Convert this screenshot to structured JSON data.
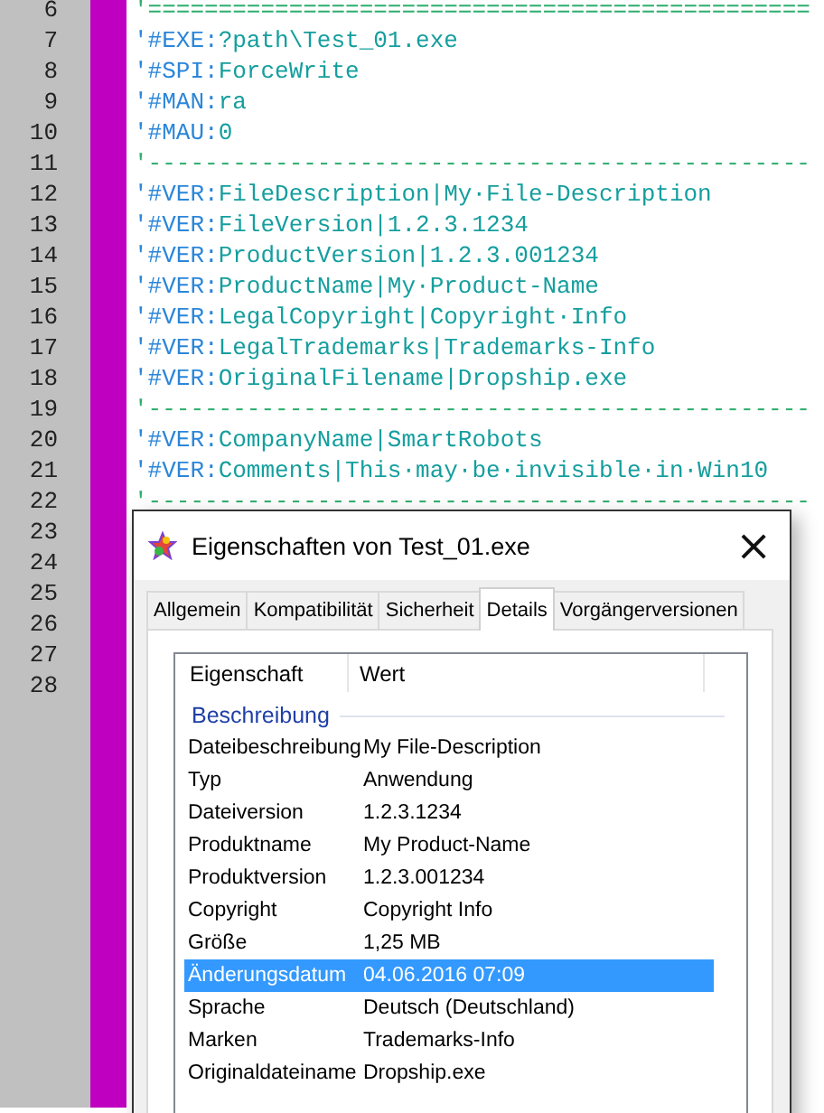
{
  "editor": {
    "lines": [
      {
        "number": "6",
        "kind": "separator",
        "text": "'==============================================="
      },
      {
        "number": "7",
        "kind": "directive",
        "key": "'#EXE:",
        "value": "?path\\Test_01.exe"
      },
      {
        "number": "8",
        "kind": "directive",
        "key": "'#SPI:",
        "value": "ForceWrite"
      },
      {
        "number": "9",
        "kind": "directive",
        "key": "'#MAN:",
        "value": "ra"
      },
      {
        "number": "10",
        "kind": "directive",
        "key": "'#MAU:",
        "value": "0"
      },
      {
        "number": "11",
        "kind": "separator",
        "text": "'-----------------------------------------------"
      },
      {
        "number": "12",
        "kind": "directive",
        "key": "'#VER:",
        "value": "FileDescription|My·File-Description"
      },
      {
        "number": "13",
        "kind": "directive",
        "key": "'#VER:",
        "value": "FileVersion|1.2.3.1234"
      },
      {
        "number": "14",
        "kind": "directive",
        "key": "'#VER:",
        "value": "ProductVersion|1.2.3.001234"
      },
      {
        "number": "15",
        "kind": "directive",
        "key": "'#VER:",
        "value": "ProductName|My·Product-Name"
      },
      {
        "number": "16",
        "kind": "directive",
        "key": "'#VER:",
        "value": "LegalCopyright|Copyright·Info"
      },
      {
        "number": "17",
        "kind": "directive",
        "key": "'#VER:",
        "value": "LegalTrademarks|Trademarks-Info"
      },
      {
        "number": "18",
        "kind": "directive",
        "key": "'#VER:",
        "value": "OriginalFilename|Dropship.exe"
      },
      {
        "number": "19",
        "kind": "separator",
        "text": "'-----------------------------------------------"
      },
      {
        "number": "20",
        "kind": "directive",
        "key": "'#VER:",
        "value": "CompanyName|SmartRobots"
      },
      {
        "number": "21",
        "kind": "directive",
        "key": "'#VER:",
        "value": "Comments|This·may·be·invisible·in·Win10"
      },
      {
        "number": "22",
        "kind": "separator",
        "text": "'-----------------------------------------------"
      },
      {
        "number": "23",
        "kind": "hidden"
      },
      {
        "number": "24",
        "kind": "hidden"
      },
      {
        "number": "25",
        "kind": "hidden"
      },
      {
        "number": "26",
        "kind": "hidden"
      },
      {
        "number": "27",
        "kind": "hidden"
      },
      {
        "number": "28",
        "kind": "hidden"
      }
    ]
  },
  "dialog": {
    "title": "Eigenschaften von Test_01.exe",
    "close": "×",
    "tabs": [
      {
        "label": "Allgemein",
        "selected": false
      },
      {
        "label": "Kompatibilität",
        "selected": false
      },
      {
        "label": "Sicherheit",
        "selected": false
      },
      {
        "label": "Details",
        "selected": true
      },
      {
        "label": "Vorgängerversionen",
        "selected": false
      }
    ],
    "columns": [
      "Eigenschaft",
      "Wert"
    ],
    "group": "Beschreibung",
    "rows": [
      {
        "name": "Dateibeschreibung",
        "value": "My File-Description",
        "selected": false
      },
      {
        "name": "Typ",
        "value": "Anwendung",
        "selected": false
      },
      {
        "name": "Dateiversion",
        "value": "1.2.3.1234",
        "selected": false
      },
      {
        "name": "Produktname",
        "value": "My Product-Name",
        "selected": false
      },
      {
        "name": "Produktversion",
        "value": "1.2.3.001234",
        "selected": false
      },
      {
        "name": "Copyright",
        "value": "Copyright Info",
        "selected": false
      },
      {
        "name": "Größe",
        "value": "1,25 MB",
        "selected": false
      },
      {
        "name": "Änderungsdatum",
        "value": "04.06.2016 07:09",
        "selected": true
      },
      {
        "name": "Sprache",
        "value": "Deutsch (Deutschland)",
        "selected": false
      },
      {
        "name": "Marken",
        "value": "Trademarks-Info",
        "selected": false
      },
      {
        "name": "Originaldateiname",
        "value": "Dropship.exe",
        "selected": false
      }
    ]
  }
}
